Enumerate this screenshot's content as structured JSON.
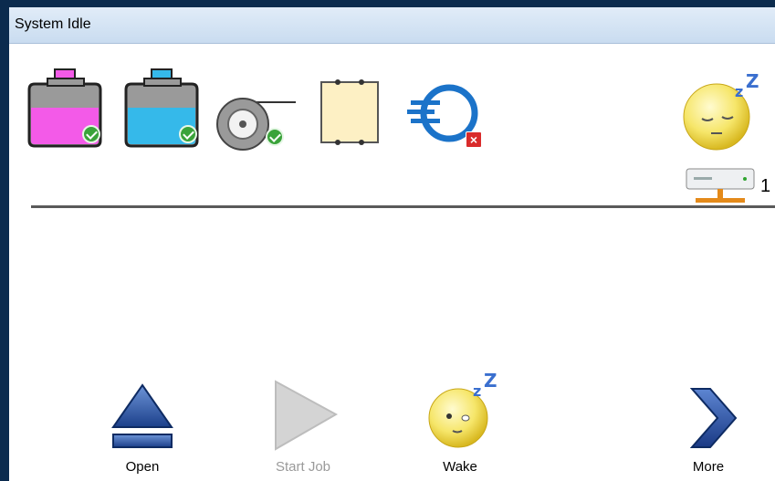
{
  "window": {
    "title": "System Idle"
  },
  "status_icons": [
    {
      "name": "magenta-ink-cartridge-icon",
      "status": "ok",
      "color": "#f35ae8"
    },
    {
      "name": "cyan-ink-cartridge-icon",
      "status": "ok",
      "color": "#35b9ea"
    },
    {
      "name": "ribbon-roll-icon",
      "status": "ok"
    },
    {
      "name": "media-label-icon",
      "status": "neutral"
    },
    {
      "name": "connection-icon",
      "status": "error"
    },
    {
      "name": "sleep-face-icon",
      "status": "sleeping"
    }
  ],
  "network": {
    "count": "1"
  },
  "actions": {
    "open_label": "Open",
    "start_job_label": "Start Job",
    "wake_label": "Wake",
    "more_label": "More"
  }
}
